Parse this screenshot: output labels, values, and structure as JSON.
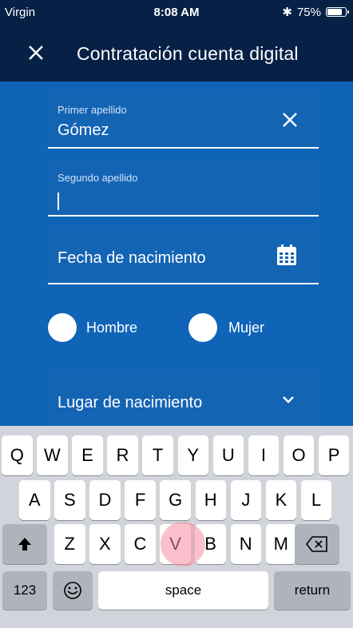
{
  "status_bar": {
    "carrier": "Virgin",
    "time": "8:08 AM",
    "bluetooth": "✱",
    "battery": "75%"
  },
  "header": {
    "title": "Contratación cuenta digital",
    "close_icon": "close-icon"
  },
  "form": {
    "first_surname": {
      "label": "Primer apellido",
      "value": "Gómez"
    },
    "second_surname": {
      "label": "Segundo apellido",
      "value": ""
    },
    "birth_date": {
      "label": "Fecha de nacimiento"
    },
    "gender": {
      "male": "Hombre",
      "female": "Mujer"
    },
    "birth_place": {
      "label": "Lugar de nacimiento"
    }
  },
  "keyboard": {
    "row1": [
      "Q",
      "W",
      "E",
      "R",
      "T",
      "Y",
      "U",
      "I",
      "O",
      "P"
    ],
    "row2": [
      "A",
      "S",
      "D",
      "F",
      "G",
      "H",
      "J",
      "K",
      "L"
    ],
    "row3": [
      "Z",
      "X",
      "C",
      "V",
      "B",
      "N",
      "M"
    ],
    "numbers_key": "123",
    "space_key": "space",
    "return_key": "return"
  },
  "colors": {
    "header_bg": "#072146",
    "form_bg": "#0f64b8",
    "field_bg": "#1464b4"
  }
}
